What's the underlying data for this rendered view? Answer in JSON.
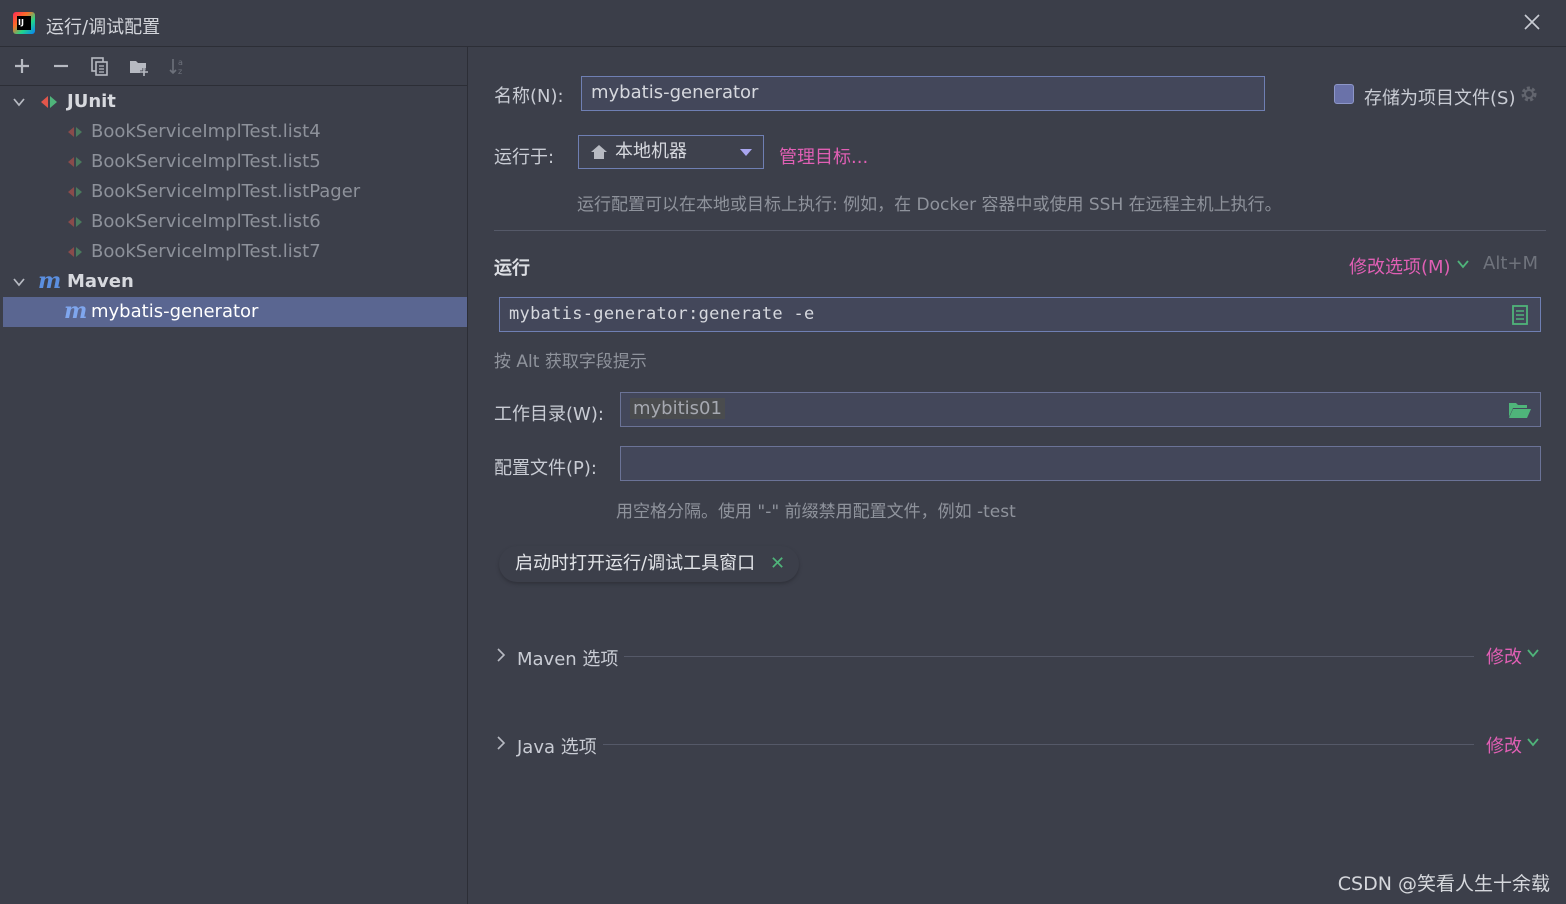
{
  "window": {
    "title": "运行/调试配置"
  },
  "tree": {
    "groups": [
      {
        "label": "JUnit",
        "items": [
          "BookServiceImplTest.list4",
          "BookServiceImplTest.list5",
          "BookServiceImplTest.listPager",
          "BookServiceImplTest.list6",
          "BookServiceImplTest.list7"
        ]
      },
      {
        "label": "Maven",
        "items": [
          "mybatis-generator"
        ]
      }
    ],
    "selected": "mybatis-generator"
  },
  "form": {
    "name_label": "名称(N):",
    "name_value": "mybatis-generator",
    "store_label": "存储为项目文件(S)",
    "run_on_label": "运行于:",
    "run_on_value": "本地机器",
    "manage_targets": "管理目标...",
    "run_on_hint": "运行配置可以在本地或目标上执行: 例如，在 Docker 容器中或使用 SSH 在远程主机上执行。",
    "run_section": "运行",
    "modify_options": "修改选项(M)",
    "modify_shortcut": "Alt+M",
    "command_value": "mybatis-generator:generate -e",
    "command_hint": "按 Alt 获取字段提示",
    "workdir_label": "工作目录(W):",
    "workdir_value": "mybitis01",
    "profiles_label": "配置文件(P):",
    "profiles_value": "",
    "profiles_hint": "用空格分隔。使用 \"-\" 前缀禁用配置文件，例如 -test",
    "tag_label": "启动时打开运行/调试工具窗口",
    "maven_options": "Maven 选项",
    "java_options": "Java 选项",
    "modify": "修改"
  },
  "watermark": "CSDN @笑看人生十余载",
  "colors": {
    "background": "#3c3f4a",
    "selection": "#5a6691",
    "accent_pink": "#e05fb4",
    "accent_green": "#4fb47a"
  }
}
